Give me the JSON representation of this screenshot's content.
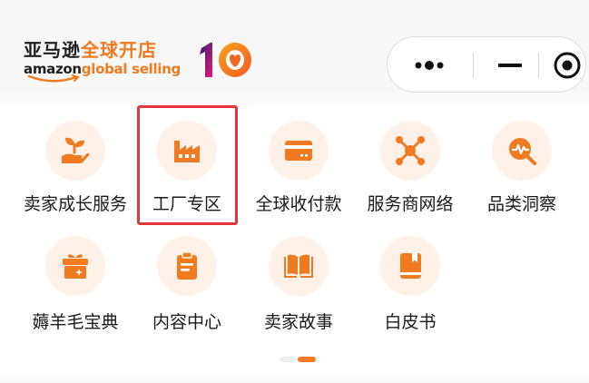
{
  "header": {
    "logo_cn_part1": "亚马逊",
    "logo_cn_part2": "全球开店",
    "logo_en_part1": "amazon",
    "logo_en_part2": "global selling",
    "anniversary_badge": "10"
  },
  "capsule": {
    "more_icon": "more-dots-icon",
    "minimize_icon": "minimize-icon",
    "close_icon": "target-circle-icon"
  },
  "grid": {
    "items": [
      {
        "label": "卖家成长服务",
        "icon": "seedling-hand-icon"
      },
      {
        "label": "工厂专区",
        "icon": "factory-icon"
      },
      {
        "label": "全球收付款",
        "icon": "card-icon"
      },
      {
        "label": "服务商网络",
        "icon": "network-icon"
      },
      {
        "label": "品类洞察",
        "icon": "insight-search-icon"
      },
      {
        "label": "薅羊毛宝典",
        "icon": "gift-box-icon"
      },
      {
        "label": "内容中心",
        "icon": "clipboard-icon"
      },
      {
        "label": "卖家故事",
        "icon": "open-book-icon"
      },
      {
        "label": "白皮书",
        "icon": "book-icon"
      }
    ],
    "highlighted_item": "工厂专区"
  },
  "pager": {
    "total_pages": 2,
    "current_page": 2
  },
  "colors": {
    "accent": "#f07a1f",
    "icon_bg": "#fff1e8",
    "highlight_border": "#e5353b"
  }
}
